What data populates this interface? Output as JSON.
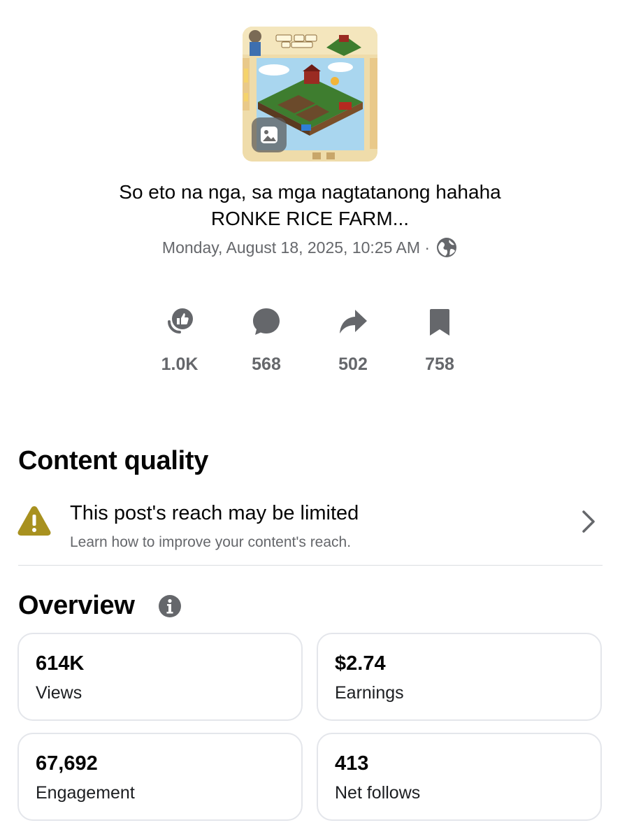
{
  "post": {
    "title_line1": "So eto na nga, sa mga nagtatanong hahaha",
    "title_line2": "RONKE RICE FARM...",
    "date": "Monday, August 18, 2025, 10:25 AM ·",
    "privacy_icon": "globe-icon"
  },
  "stats": [
    {
      "icon": "like-icon",
      "value": "1.0K"
    },
    {
      "icon": "comment-icon",
      "value": "568"
    },
    {
      "icon": "share-icon",
      "value": "502"
    },
    {
      "icon": "save-icon",
      "value": "758"
    }
  ],
  "content_quality": {
    "heading": "Content quality",
    "warning_title": "This post's reach may be limited",
    "warning_subtitle": "Learn how to improve your content's reach.",
    "warning_color": "#a8911f"
  },
  "overview": {
    "heading": "Overview",
    "cards": [
      {
        "value": "614K",
        "label": "Views"
      },
      {
        "value": "$2.74",
        "label": "Earnings"
      },
      {
        "value": "67,692",
        "label": "Engagement"
      },
      {
        "value": "413",
        "label": "Net follows"
      }
    ]
  }
}
